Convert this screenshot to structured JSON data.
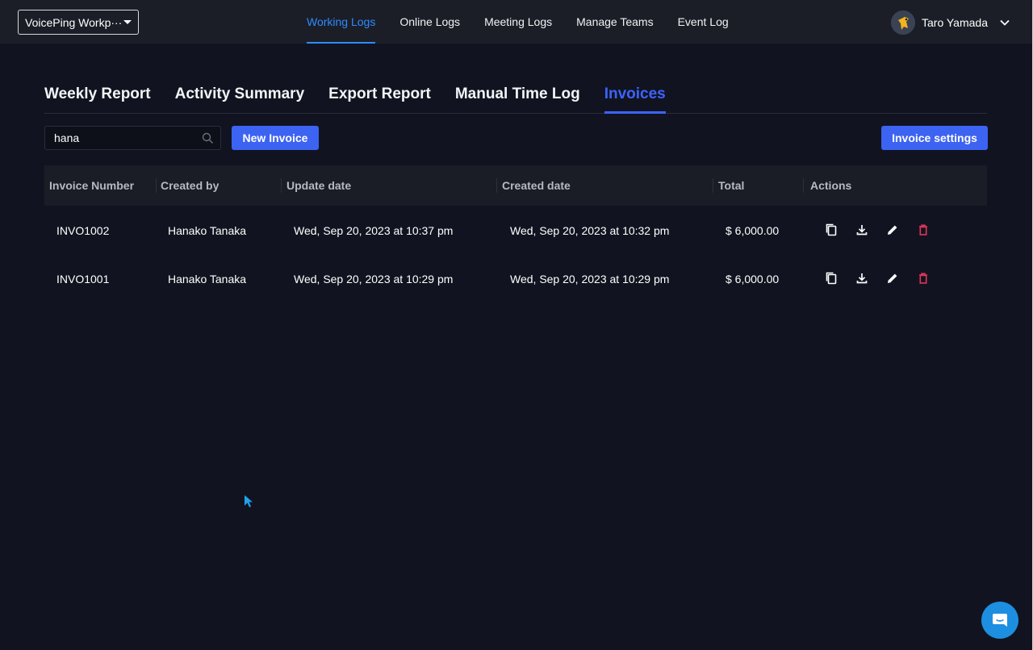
{
  "workspace": {
    "label": "VoicePing Workp···"
  },
  "topnav": {
    "items": [
      {
        "label": "Working Logs",
        "active": true
      },
      {
        "label": "Online Logs",
        "active": false
      },
      {
        "label": "Meeting Logs",
        "active": false
      },
      {
        "label": "Manage Teams",
        "active": false
      },
      {
        "label": "Event Log",
        "active": false
      }
    ]
  },
  "user": {
    "name": "Taro Yamada",
    "avatar_icon": "bird-avatar"
  },
  "subtabs": [
    {
      "label": "Weekly Report",
      "active": false
    },
    {
      "label": "Activity Summary",
      "active": false
    },
    {
      "label": "Export Report",
      "active": false
    },
    {
      "label": "Manual Time Log",
      "active": false
    },
    {
      "label": "Invoices",
      "active": true
    }
  ],
  "toolbar": {
    "search_value": "hana",
    "new_invoice_label": "New Invoice",
    "invoice_settings_label": "Invoice settings"
  },
  "table": {
    "headers": [
      "Invoice Number",
      "Created by",
      "Update date",
      "Created date",
      "Total",
      "Actions"
    ],
    "rows": [
      {
        "invoice_number": "INVO1002",
        "created_by": "Hanako Tanaka",
        "update_date": "Wed, Sep 20, 2023 at 10:37 pm",
        "created_date": "Wed, Sep 20, 2023 at 10:32 pm",
        "total": "$ 6,000.00"
      },
      {
        "invoice_number": "INVO1001",
        "created_by": "Hanako Tanaka",
        "update_date": "Wed, Sep 20, 2023 at 10:29 pm",
        "created_date": "Wed, Sep 20, 2023 at 10:29 pm",
        "total": "$ 6,000.00"
      }
    ],
    "action_icons": [
      "copy-icon",
      "download-icon",
      "edit-icon",
      "delete-icon"
    ]
  },
  "colors": {
    "background": "#111420",
    "topbar": "#1b1e27",
    "accent": "#2e8cff",
    "tab_active": "#3e63ff",
    "button": "#3d63f2",
    "delete": "#e0355a",
    "chat": "#1d8fe1"
  }
}
